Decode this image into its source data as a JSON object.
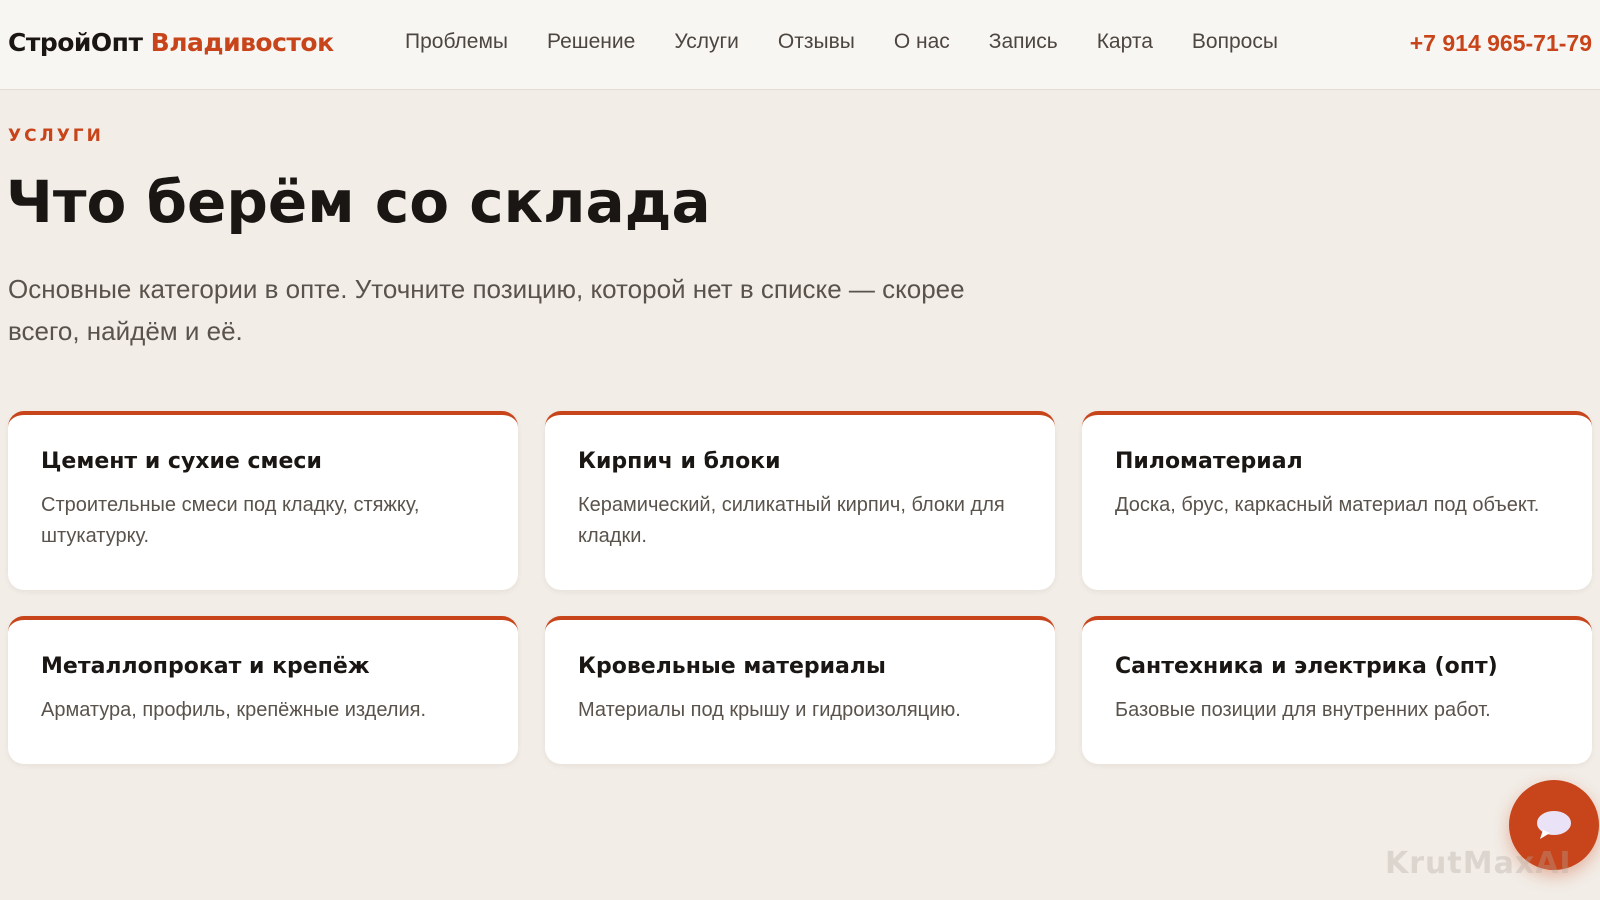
{
  "header": {
    "logo_main": "СтройОпт",
    "logo_accent": "Владивосток",
    "nav": [
      "Проблемы",
      "Решение",
      "Услуги",
      "Отзывы",
      "О нас",
      "Запись",
      "Карта",
      "Вопросы"
    ],
    "phone": "+7 914 965-71-79"
  },
  "section": {
    "eyebrow": "УСЛУГИ",
    "title": "Что берём со склада",
    "lead": "Основные категории в опте. Уточните позицию, которой нет в списке — скорее всего, найдём и её."
  },
  "cards": [
    {
      "title": "Цемент и сухие смеси",
      "text": "Строительные смеси под кладку, стяжку, штукатурку."
    },
    {
      "title": "Кирпич и блоки",
      "text": "Керамический, силикатный кирпич, блоки для кладки."
    },
    {
      "title": "Пиломатериал",
      "text": "Доска, брус, каркасный материал под объект."
    },
    {
      "title": "Металлопрокат и крепёж",
      "text": "Арматура, профиль, крепёжные изделия."
    },
    {
      "title": "Кровельные материалы",
      "text": "Материалы под крышу и гидроизоляцию."
    },
    {
      "title": "Сантехника и электрика (опт)",
      "text": "Базовые позиции для внутренних работ."
    }
  ],
  "chat_button": {
    "icon": "chat-bubble-icon"
  },
  "watermark": "KrutMaxAI",
  "colors": {
    "accent": "#c8441a",
    "background": "#f2ede7",
    "card": "#ffffff",
    "text": "#1a1613"
  }
}
